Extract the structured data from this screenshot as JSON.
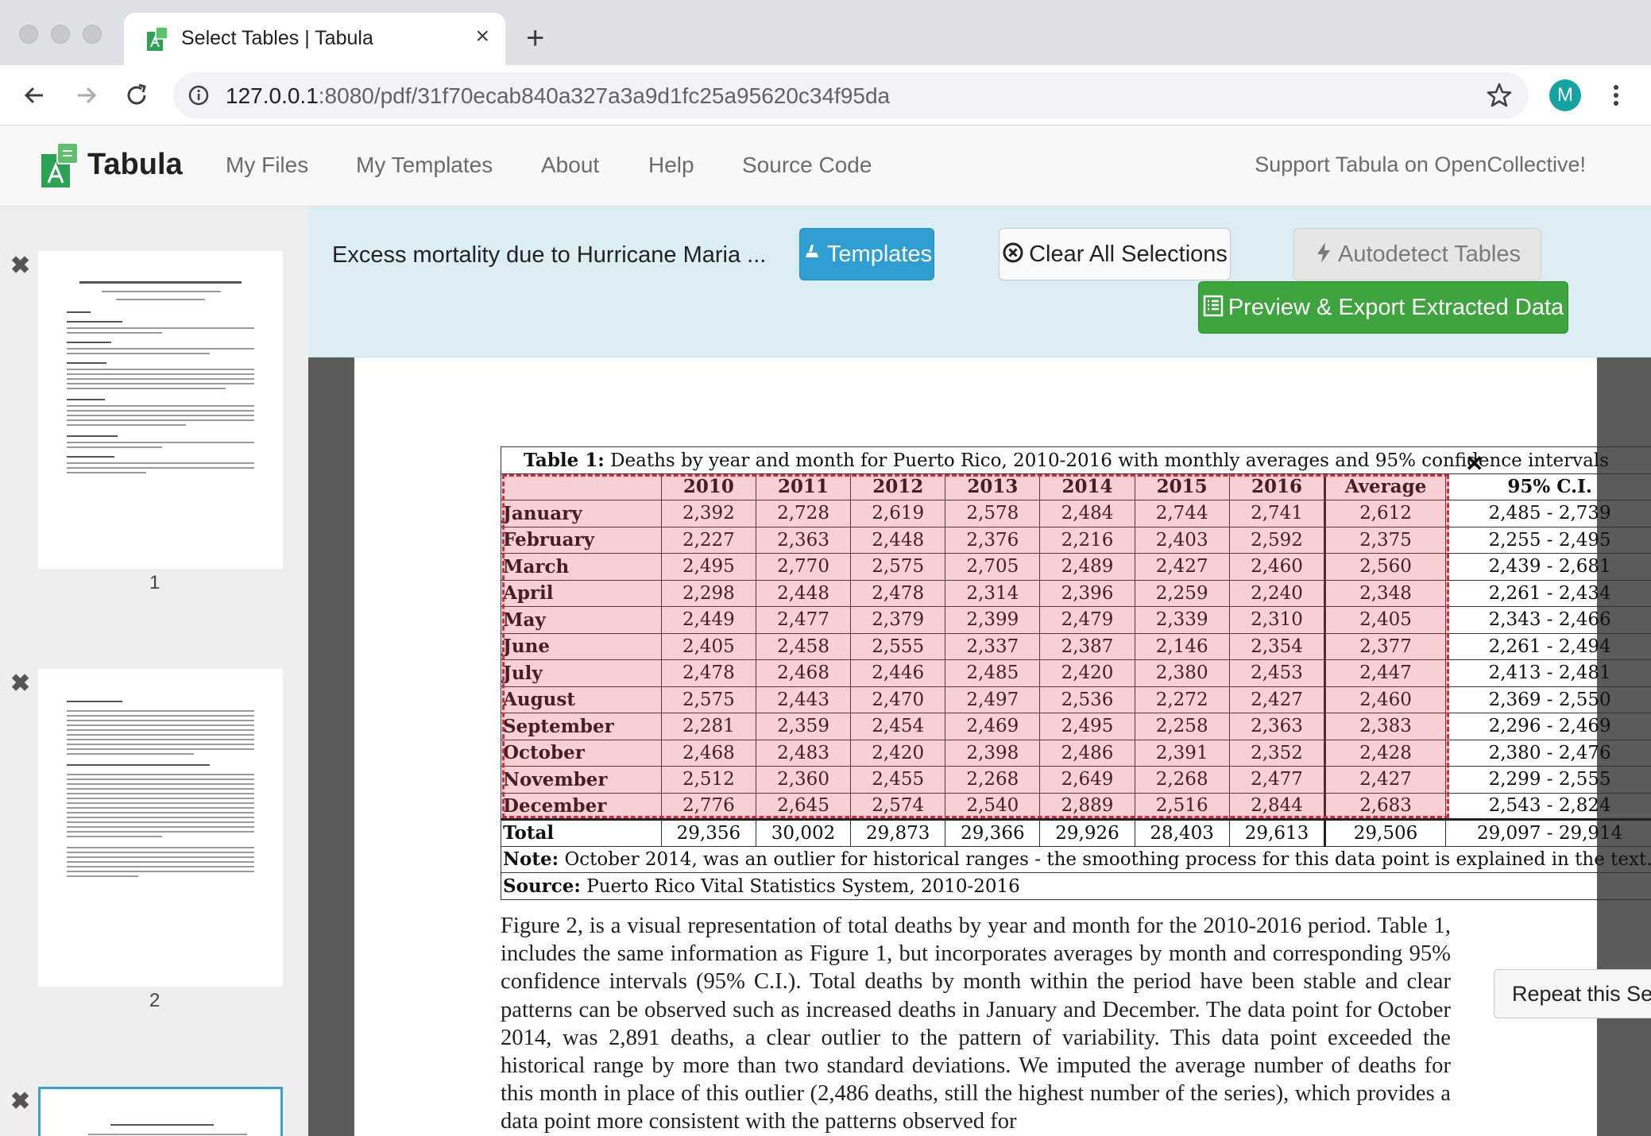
{
  "browser": {
    "tab_title": "Select Tables | Tabula",
    "url_host": "127.0.0.1",
    "url_rest": ":8080/pdf/31f70ecab840a327a3a9d1fc25a95620c34f95da",
    "avatar_initial": "M"
  },
  "nav": {
    "brand": "Tabula",
    "links": [
      "My Files",
      "My Templates",
      "About",
      "Help",
      "Source Code"
    ],
    "support": "Support Tabula on OpenCollective!"
  },
  "sidebar": {
    "pages": [
      "1",
      "2"
    ]
  },
  "actionbar": {
    "doc_name": "Excess mortality due to Hurricane Maria ...",
    "templates_label": "Templates",
    "clear_label": "Clear All Selections",
    "autodetect_label": "Autodetect Tables",
    "export_label": "Preview & Export Extracted Data"
  },
  "table": {
    "caption_bold": "Table 1:",
    "caption_text": "Deaths by year and month for Puerto Rico, 2010-2016 with monthly averages and 95% confidence intervals",
    "headers": [
      "2010",
      "2011",
      "2012",
      "2013",
      "2014",
      "2015",
      "2016",
      "Average",
      "95% C.I."
    ],
    "rows": [
      [
        "January",
        "2,392",
        "2,728",
        "2,619",
        "2,578",
        "2,484",
        "2,744",
        "2,741",
        "2,612",
        "2,485 - 2,739"
      ],
      [
        "February",
        "2,227",
        "2,363",
        "2,448",
        "2,376",
        "2,216",
        "2,403",
        "2,592",
        "2,375",
        "2,255 - 2,495"
      ],
      [
        "March",
        "2,495",
        "2,770",
        "2,575",
        "2,705",
        "2,489",
        "2,427",
        "2,460",
        "2,560",
        "2,439 - 2,681"
      ],
      [
        "April",
        "2,298",
        "2,448",
        "2,478",
        "2,314",
        "2,396",
        "2,259",
        "2,240",
        "2,348",
        "2,261 - 2,434"
      ],
      [
        "May",
        "2,449",
        "2,477",
        "2,379",
        "2,399",
        "2,479",
        "2,339",
        "2,310",
        "2,405",
        "2,343 - 2,466"
      ],
      [
        "June",
        "2,405",
        "2,458",
        "2,555",
        "2,337",
        "2,387",
        "2,146",
        "2,354",
        "2,377",
        "2,261 - 2,494"
      ],
      [
        "July",
        "2,478",
        "2,468",
        "2,446",
        "2,485",
        "2,420",
        "2,380",
        "2,453",
        "2,447",
        "2,413 - 2,481"
      ],
      [
        "August",
        "2,575",
        "2,443",
        "2,470",
        "2,497",
        "2,536",
        "2,272",
        "2,427",
        "2,460",
        "2,369 - 2,550"
      ],
      [
        "September",
        "2,281",
        "2,359",
        "2,454",
        "2,469",
        "2,495",
        "2,258",
        "2,363",
        "2,383",
        "2,296 - 2,469"
      ],
      [
        "October",
        "2,468",
        "2,483",
        "2,420",
        "2,398",
        "2,486",
        "2,391",
        "2,352",
        "2,428",
        "2,380 - 2,476"
      ],
      [
        "November",
        "2,512",
        "2,360",
        "2,455",
        "2,268",
        "2,649",
        "2,268",
        "2,477",
        "2,427",
        "2,299 - 2,555"
      ],
      [
        "December",
        "2,776",
        "2,645",
        "2,574",
        "2,540",
        "2,889",
        "2,516",
        "2,844",
        "2,683",
        "2,543 - 2,824"
      ]
    ],
    "total": [
      "Total",
      "29,356",
      "30,002",
      "29,873",
      "29,366",
      "29,926",
      "28,403",
      "29,613",
      "29,506",
      "29,097 - 29,914"
    ],
    "note_bold": "Note:",
    "note_text": "October 2014, was an outlier for historical ranges - the smoothing process for this data point is explained in the text.",
    "source_bold": "Source:",
    "source_text": "Puerto Rico Vital Statistics System, 2010-2016"
  },
  "selection": {
    "repeat_label": "Repeat this Selecti"
  },
  "body_text": "Figure 2, is a visual representation of total deaths by year and month for the 2010-2016 period. Table 1, includes the same information as Figure 1, but incorporates averages by month and corresponding 95% confidence intervals (95% C.I.). Total deaths by month within the period have been stable and clear patterns can be observed such as increased deaths in January and December. The data point for October 2014, was 2,891 deaths, a clear outlier to the pattern of variability. This data point exceeded the historical range by more than two standard deviations. We imputed the average number of deaths for this month in place of this outlier (2,486 deaths, still the highest number of the series), which provides a data point more consistent with the patterns observed for"
}
